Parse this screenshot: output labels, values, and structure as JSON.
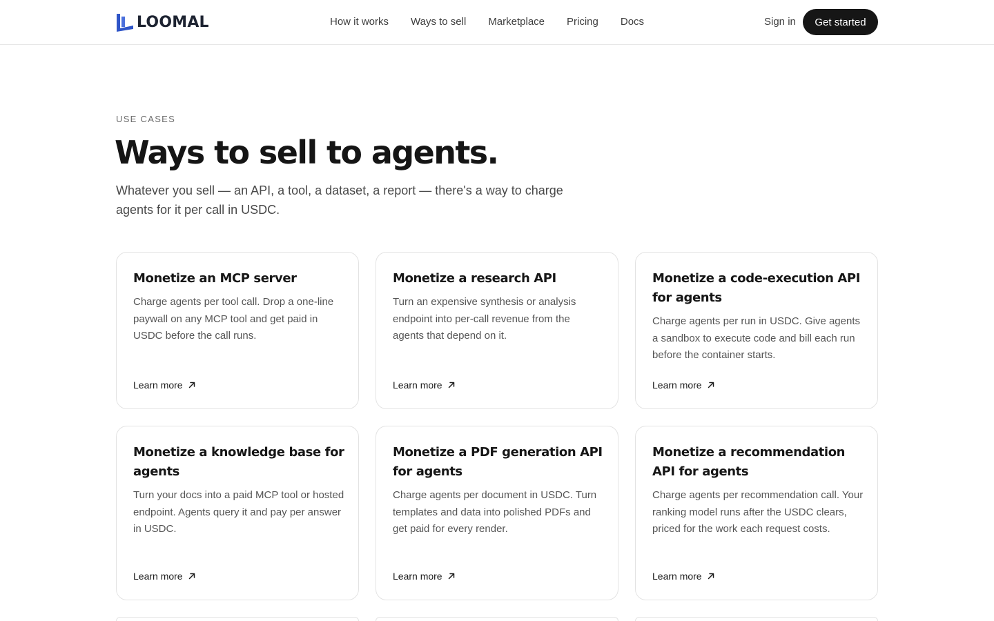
{
  "brand": {
    "name": "LOOMAL",
    "color": "#2f55c8"
  },
  "nav": {
    "links": [
      "How it works",
      "Ways to sell",
      "Marketplace",
      "Pricing",
      "Docs"
    ],
    "signin": "Sign in",
    "cta": "Get started"
  },
  "hero": {
    "eyebrow": "USE CASES",
    "title": "Ways to sell to agents.",
    "lede": "Whatever you sell — an API, a tool, a dataset, a report — there's a way to charge agents for it per call in USDC."
  },
  "cards": [
    {
      "title": "Monetize an MCP server",
      "desc": "Charge agents per tool call. Drop a one-line paywall on any MCP tool and get paid in USDC before the call runs.",
      "link": "Learn more"
    },
    {
      "title": "Monetize a research API",
      "desc": "Turn an expensive synthesis or analysis endpoint into per-call revenue from the agents that depend on it.",
      "link": "Learn more"
    },
    {
      "title": "Monetize a code-execution API for agents",
      "desc": "Charge agents per run in USDC. Give agents a sandbox to execute code and bill each run before the container starts.",
      "link": "Learn more"
    },
    {
      "title": "Monetize a knowledge base for agents",
      "desc": "Turn your docs into a paid MCP tool or hosted endpoint. Agents query it and pay per answer in USDC.",
      "link": "Learn more"
    },
    {
      "title": "Monetize a PDF generation API for agents",
      "desc": "Charge agents per document in USDC. Turn templates and data into polished PDFs and get paid for every render.",
      "link": "Learn more"
    },
    {
      "title": "Monetize a recommendation API for agents",
      "desc": "Charge agents per recommendation call. Your ranking model runs after the USDC clears, priced for the work each request costs.",
      "link": "Learn more"
    }
  ]
}
